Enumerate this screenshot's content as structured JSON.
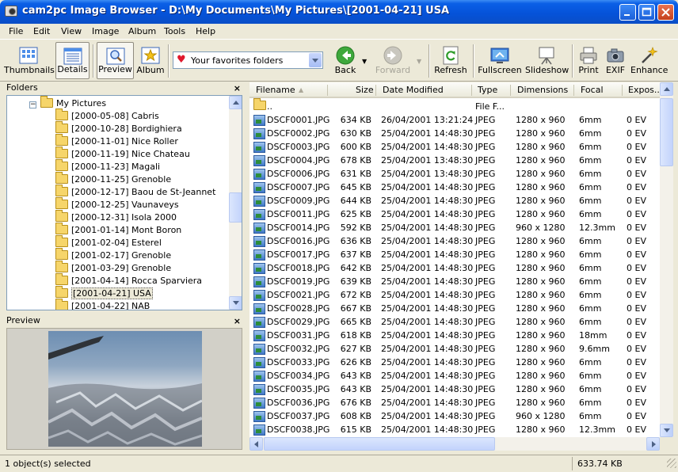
{
  "window": {
    "title": "cam2pc Image Browser - D:\\My Documents\\My Pictures\\[2001-04-21] USA"
  },
  "menu": [
    "File",
    "Edit",
    "View",
    "Image",
    "Album",
    "Tools",
    "Help"
  ],
  "toolbar": {
    "thumbnails": "Thumbnails",
    "details": "Details",
    "preview": "Preview",
    "album": "Album",
    "favorites": "Your favorites folders",
    "back": "Back",
    "forward": "Forward",
    "refresh": "Refresh",
    "fullscreen": "Fullscreen",
    "slideshow": "Slideshow",
    "print": "Print",
    "exif": "EXIF",
    "enhance": "Enhance"
  },
  "folders_panel": {
    "title": "Folders",
    "close": "×",
    "root": "My Pictures",
    "items": [
      "[2000-05-08] Cabris",
      "[2000-10-28] Bordighiera",
      "[2000-11-01] Nice Roller",
      "[2000-11-19] Nice Chateau",
      "[2000-11-23] Magali",
      "[2000-11-25] Grenoble",
      "[2000-12-17] Baou de St-Jeannet",
      "[2000-12-25] Vaunaveys",
      "[2000-12-31] Isola 2000",
      "[2001-01-14] Mont Boron",
      "[2001-02-04] Esterel",
      "[2001-02-17] Grenoble",
      "[2001-03-29] Grenoble",
      "[2001-04-14] Rocca Sparviera",
      "[2001-04-21] USA",
      "[2001-04-22] NAB"
    ],
    "selected_index": 14
  },
  "preview_panel": {
    "title": "Preview",
    "close": "×"
  },
  "file_list": {
    "columns": [
      "Filename",
      "Size",
      "Date Modified",
      "Type",
      "Dimensions",
      "Focal",
      "Expos..."
    ],
    "parent": {
      "name": "..",
      "type": "File F..."
    },
    "rows": [
      [
        "DSCF0001.JPG",
        "634 KB",
        "26/04/2001 13:21:24",
        "JPEG",
        "1280 x 960",
        "6mm",
        "0 EV"
      ],
      [
        "DSCF0002.JPG",
        "630 KB",
        "25/04/2001 14:48:30",
        "JPEG",
        "1280 x 960",
        "6mm",
        "0 EV"
      ],
      [
        "DSCF0003.JPG",
        "600 KB",
        "25/04/2001 14:48:30",
        "JPEG",
        "1280 x 960",
        "6mm",
        "0 EV"
      ],
      [
        "DSCF0004.JPG",
        "678 KB",
        "25/04/2001 13:48:30",
        "JPEG",
        "1280 x 960",
        "6mm",
        "0 EV"
      ],
      [
        "DSCF0006.JPG",
        "631 KB",
        "25/04/2001 13:48:30",
        "JPEG",
        "1280 x 960",
        "6mm",
        "0 EV"
      ],
      [
        "DSCF0007.JPG",
        "645 KB",
        "25/04/2001 14:48:30",
        "JPEG",
        "1280 x 960",
        "6mm",
        "0 EV"
      ],
      [
        "DSCF0009.JPG",
        "644 KB",
        "25/04/2001 14:48:30",
        "JPEG",
        "1280 x 960",
        "6mm",
        "0 EV"
      ],
      [
        "DSCF0011.JPG",
        "625 KB",
        "25/04/2001 14:48:30",
        "JPEG",
        "1280 x 960",
        "6mm",
        "0 EV"
      ],
      [
        "DSCF0014.JPG",
        "592 KB",
        "25/04/2001 14:48:30",
        "JPEG",
        "960 x 1280",
        "12.3mm",
        "0 EV"
      ],
      [
        "DSCF0016.JPG",
        "636 KB",
        "25/04/2001 14:48:30",
        "JPEG",
        "1280 x 960",
        "6mm",
        "0 EV"
      ],
      [
        "DSCF0017.JPG",
        "637 KB",
        "25/04/2001 14:48:30",
        "JPEG",
        "1280 x 960",
        "6mm",
        "0 EV"
      ],
      [
        "DSCF0018.JPG",
        "642 KB",
        "25/04/2001 14:48:30",
        "JPEG",
        "1280 x 960",
        "6mm",
        "0 EV"
      ],
      [
        "DSCF0019.JPG",
        "639 KB",
        "25/04/2001 14:48:30",
        "JPEG",
        "1280 x 960",
        "6mm",
        "0 EV"
      ],
      [
        "DSCF0021.JPG",
        "672 KB",
        "25/04/2001 14:48:30",
        "JPEG",
        "1280 x 960",
        "6mm",
        "0 EV"
      ],
      [
        "DSCF0028.JPG",
        "667 KB",
        "25/04/2001 14:48:30",
        "JPEG",
        "1280 x 960",
        "6mm",
        "0 EV"
      ],
      [
        "DSCF0029.JPG",
        "665 KB",
        "25/04/2001 14:48:30",
        "JPEG",
        "1280 x 960",
        "6mm",
        "0 EV"
      ],
      [
        "DSCF0031.JPG",
        "618 KB",
        "25/04/2001 14:48:30",
        "JPEG",
        "1280 x 960",
        "18mm",
        "0 EV"
      ],
      [
        "DSCF0032.JPG",
        "627 KB",
        "25/04/2001 14:48:30",
        "JPEG",
        "1280 x 960",
        "9.6mm",
        "0 EV"
      ],
      [
        "DSCF0033.JPG",
        "626 KB",
        "25/04/2001 14:48:30",
        "JPEG",
        "1280 x 960",
        "6mm",
        "0 EV"
      ],
      [
        "DSCF0034.JPG",
        "643 KB",
        "25/04/2001 14:48:30",
        "JPEG",
        "1280 x 960",
        "6mm",
        "0 EV"
      ],
      [
        "DSCF0035.JPG",
        "643 KB",
        "25/04/2001 14:48:30",
        "JPEG",
        "1280 x 960",
        "6mm",
        "0 EV"
      ],
      [
        "DSCF0036.JPG",
        "676 KB",
        "25/04/2001 14:48:30",
        "JPEG",
        "1280 x 960",
        "6mm",
        "0 EV"
      ],
      [
        "DSCF0037.JPG",
        "608 KB",
        "25/04/2001 14:48:30",
        "JPEG",
        "960 x 1280",
        "6mm",
        "0 EV"
      ],
      [
        "DSCF0038.JPG",
        "615 KB",
        "25/04/2001 14:48:30",
        "JPEG",
        "1280 x 960",
        "12.3mm",
        "0 EV"
      ]
    ]
  },
  "status": {
    "selection": "1 object(s) selected",
    "size": "633.74 KB"
  }
}
